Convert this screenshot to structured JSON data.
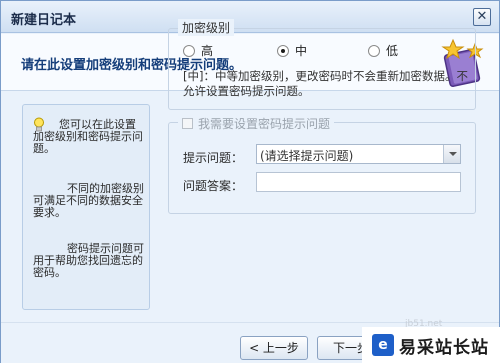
{
  "window": {
    "title": "新建日记本",
    "close_label": "✕"
  },
  "header": {
    "text": "请在此设置加密级别和密码提示问题。",
    "icon": "notebook-stars-icon"
  },
  "tips": [
    "您可以在此设置加密级别和密码提示问题。",
    "不同的加密级别可满足不同的数据安全要求。",
    "密码提示问题可用于帮助您找回遗忘的密码。"
  ],
  "encryption": {
    "legend": "加密级别",
    "options": [
      {
        "label": "高",
        "checked": false
      },
      {
        "label": "中",
        "checked": true
      },
      {
        "label": "低",
        "checked": false
      }
    ],
    "description": "[中]：中等加密级别，更改密码时不会重新加密数据。不允许设置密码提示问题。"
  },
  "password_hint": {
    "checkbox_label": "我需要设置密码提示问题",
    "checked": false,
    "enabled": false,
    "question_label": "提示问题：",
    "question_value": "(请选择提示问题)",
    "answer_label": "问题答案：",
    "answer_value": ""
  },
  "buttons": {
    "prev": "< 上一步",
    "next": "下一步"
  },
  "watermark": {
    "logo": "e",
    "text": "易采站长站",
    "url": "jb51.net"
  }
}
